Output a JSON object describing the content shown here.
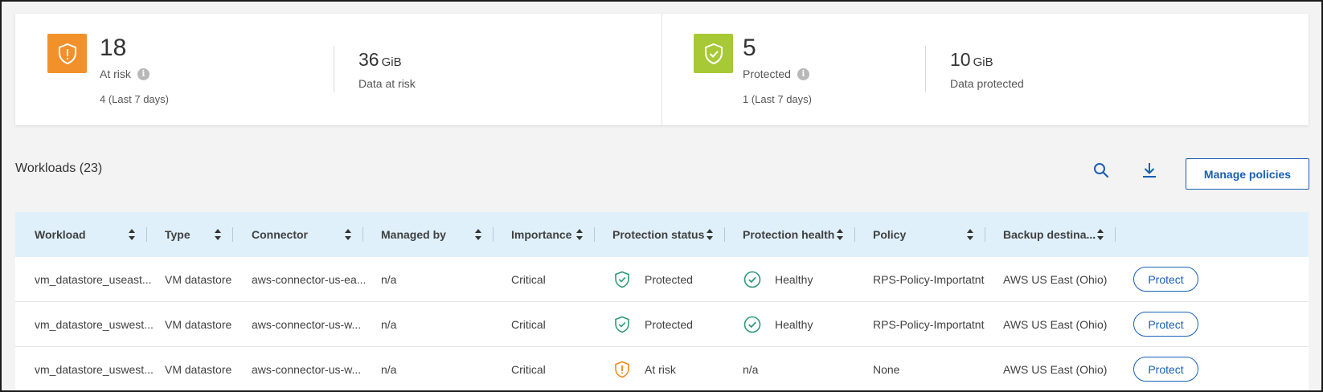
{
  "summary": {
    "at_risk": {
      "count": "18",
      "label": "At risk",
      "last7": "4 (Last 7 days)",
      "size_value": "36",
      "size_unit": "GiB",
      "size_label": "Data at risk",
      "icon": "shield-alert-icon",
      "color": "#f2902a"
    },
    "protected": {
      "count": "5",
      "label": "Protected",
      "last7": "1 (Last 7 days)",
      "size_value": "10",
      "size_unit": "GiB",
      "size_label": "Data protected",
      "icon": "shield-check-icon",
      "color": "#a6c935"
    }
  },
  "workloads": {
    "title": "Workloads (23)",
    "manage_label": "Manage policies",
    "search_icon": "search-icon",
    "download_icon": "download-icon"
  },
  "table": {
    "columns": [
      "Workload",
      "Type",
      "Connector",
      "Managed by",
      "Importance",
      "Protection status",
      "Protection health",
      "Policy",
      "Backup destina..."
    ],
    "rows": [
      {
        "workload": "vm_datastore_useast...",
        "type": "VM datastore",
        "connector": "aws-connector-us-ea...",
        "managed_by": "n/a",
        "importance": "Critical",
        "status": "Protected",
        "status_icon": "shield-check-icon",
        "health": "Healthy",
        "health_icon": "check-circle-icon",
        "policy": "RPS-Policy-Importatnt",
        "backup": "AWS US East (Ohio)",
        "action": "Protect"
      },
      {
        "workload": "vm_datastore_uswest...",
        "type": "VM datastore",
        "connector": "aws-connector-us-w...",
        "managed_by": "n/a",
        "importance": "Critical",
        "status": "Protected",
        "status_icon": "shield-check-icon",
        "health": "Healthy",
        "health_icon": "check-circle-icon",
        "policy": "RPS-Policy-Importatnt",
        "backup": "AWS US East (Ohio)",
        "action": "Protect"
      },
      {
        "workload": "vm_datastore_uswest...",
        "type": "VM datastore",
        "connector": "aws-connector-us-w...",
        "managed_by": "n/a",
        "importance": "Critical",
        "status": "At risk",
        "status_icon": "shield-alert-icon",
        "health": "n/a",
        "health_icon": "",
        "policy": "None",
        "backup": "AWS US East (Ohio)",
        "action": "Protect"
      }
    ]
  },
  "colors": {
    "accent": "#1a5fb4",
    "header_bg": "#dff0fb",
    "healthy": "#2e9a75",
    "warning": "#f08a1c"
  }
}
